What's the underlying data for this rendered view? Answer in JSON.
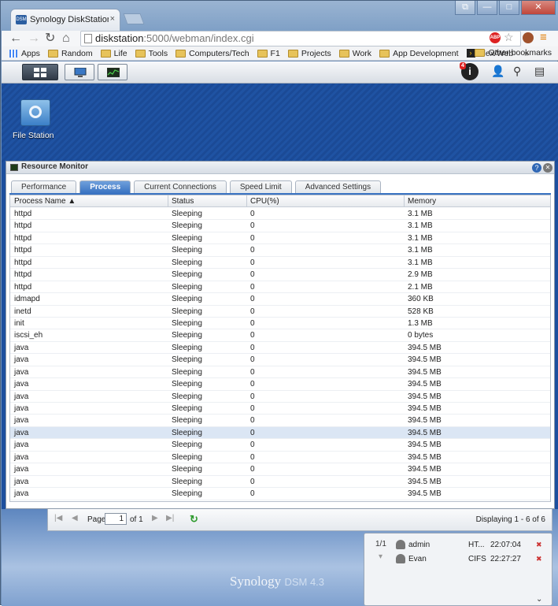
{
  "browser": {
    "tab_title": "Synology DiskStation - Di",
    "tab_favicon": "DSM",
    "tab_close": "×",
    "url_host": "diskstation",
    "url_rest": ":5000/webman/index.cgi",
    "window_controls": [
      "⧉",
      "—",
      "□",
      "✕"
    ],
    "bookmarks": [
      {
        "label": "Apps",
        "icon": "apps-icon"
      },
      {
        "label": "Random",
        "icon": "folder-icon"
      },
      {
        "label": "Life",
        "icon": "folder-icon"
      },
      {
        "label": "Tools",
        "icon": "folder-icon"
      },
      {
        "label": "Computers/Tech",
        "icon": "folder-icon"
      },
      {
        "label": "F1",
        "icon": "folder-icon"
      },
      {
        "label": "Projects",
        "icon": "folder-icon"
      },
      {
        "label": "Work",
        "icon": "folder-icon"
      },
      {
        "label": "App Development",
        "icon": "folder-icon"
      },
      {
        "label": "Plex/Web",
        "icon": "plex-icon"
      }
    ],
    "bookmarks_overflow": "»",
    "other_bookmarks": "Other bookmarks"
  },
  "dsm": {
    "notification_count": "4",
    "notification_glyph": "i",
    "desktop_icon_label": "File Station",
    "brand": "Synology",
    "version": "DSM 4.3"
  },
  "resource_monitor": {
    "title": "Resource Monitor",
    "help": "?",
    "tabs": [
      "Performance",
      "Process",
      "Current Connections",
      "Speed Limit",
      "Advanced Settings"
    ],
    "selected_tab": "Process",
    "columns": [
      "Process Name ▲",
      "Status",
      "CPU(%)",
      "Memory"
    ],
    "rows": [
      [
        "httpd",
        "Sleeping",
        "0",
        "3.1 MB"
      ],
      [
        "httpd",
        "Sleeping",
        "0",
        "3.1 MB"
      ],
      [
        "httpd",
        "Sleeping",
        "0",
        "3.1 MB"
      ],
      [
        "httpd",
        "Sleeping",
        "0",
        "3.1 MB"
      ],
      [
        "httpd",
        "Sleeping",
        "0",
        "3.1 MB"
      ],
      [
        "httpd",
        "Sleeping",
        "0",
        "2.9 MB"
      ],
      [
        "httpd",
        "Sleeping",
        "0",
        "2.1 MB"
      ],
      [
        "idmapd",
        "Sleeping",
        "0",
        "360 KB"
      ],
      [
        "inetd",
        "Sleeping",
        "0",
        "528 KB"
      ],
      [
        "init",
        "Sleeping",
        "0",
        "1.3 MB"
      ],
      [
        "iscsi_eh",
        "Sleeping",
        "0",
        "0 bytes"
      ],
      [
        "java",
        "Sleeping",
        "0",
        "394.5 MB"
      ],
      [
        "java",
        "Sleeping",
        "0",
        "394.5 MB"
      ],
      [
        "java",
        "Sleeping",
        "0",
        "394.5 MB"
      ],
      [
        "java",
        "Sleeping",
        "0",
        "394.5 MB"
      ],
      [
        "java",
        "Sleeping",
        "0",
        "394.5 MB"
      ],
      [
        "java",
        "Sleeping",
        "0",
        "394.5 MB"
      ],
      [
        "java",
        "Sleeping",
        "0",
        "394.5 MB"
      ],
      [
        "java",
        "Sleeping",
        "0",
        "394.5 MB"
      ],
      [
        "java",
        "Sleeping",
        "0",
        "394.5 MB"
      ],
      [
        "java",
        "Sleeping",
        "0",
        "394.5 MB"
      ],
      [
        "java",
        "Sleeping",
        "0",
        "394.5 MB"
      ],
      [
        "java",
        "Sleeping",
        "0",
        "394.5 MB"
      ],
      [
        "java",
        "Sleeping",
        "0",
        "394.5 MB"
      ]
    ],
    "selected_row": 18
  },
  "pager": {
    "first": "|◀",
    "prev": "◀",
    "page_label": "Page",
    "page_value": "1",
    "of_label": "of 1",
    "next": "▶",
    "last": "▶|",
    "refresh": "↻",
    "display_text": "Displaying 1 - 6 of 6"
  },
  "connections_widget": {
    "page": "1/1",
    "page_down": "▾",
    "rows": [
      {
        "user": "admin",
        "type": "HT...",
        "time": "22:07:04",
        "action": "✖"
      },
      {
        "user": "Evan",
        "type": "CIFS",
        "time": "22:27:27",
        "action": "✖"
      }
    ],
    "collapse": "⌄"
  }
}
